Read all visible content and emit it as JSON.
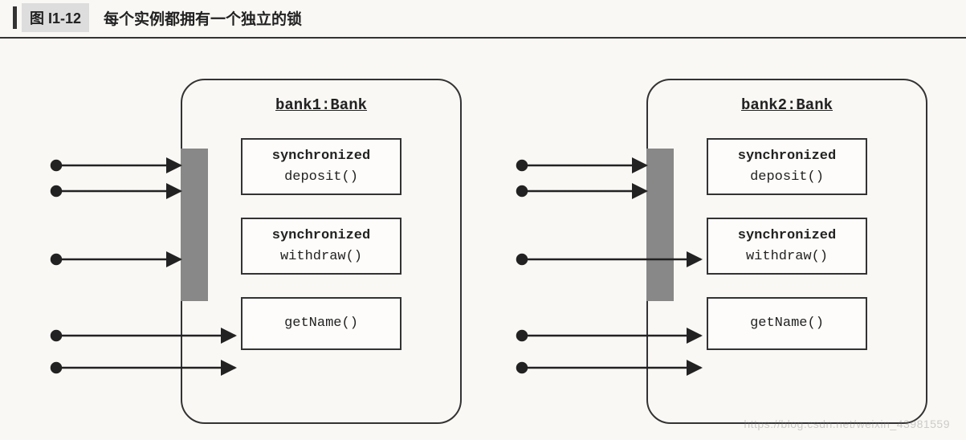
{
  "header": {
    "figure_label": "图 I1-12",
    "caption": "每个实例都拥有一个独立的锁"
  },
  "instances": [
    {
      "title": "bank1:Bank",
      "methods": [
        {
          "sync": "synchronized",
          "name": "deposit()"
        },
        {
          "sync": "synchronized",
          "name": "withdraw()"
        },
        {
          "sync": "",
          "name": "getName()"
        }
      ]
    },
    {
      "title": "bank2:Bank",
      "methods": [
        {
          "sync": "synchronized",
          "name": "deposit()"
        },
        {
          "sync": "synchronized",
          "name": "withdraw()"
        },
        {
          "sync": "",
          "name": "getName()"
        }
      ]
    }
  ],
  "watermark": "https://blog.csdn.net/weixin_43981559"
}
